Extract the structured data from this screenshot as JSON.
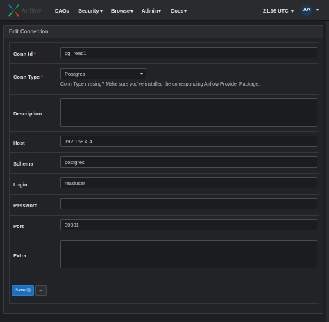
{
  "navbar": {
    "logo_text": "Airflow",
    "items": [
      {
        "label": "DAGs",
        "dropdown": false
      },
      {
        "label": "Security",
        "dropdown": true
      },
      {
        "label": "Browse",
        "dropdown": true
      },
      {
        "label": "Admin",
        "dropdown": true
      },
      {
        "label": "Docs",
        "dropdown": true
      }
    ],
    "time": "21:16 UTC",
    "avatar": "AA"
  },
  "panel": {
    "title": "Edit Connection"
  },
  "form": {
    "conn_id": {
      "label": "Conn Id",
      "required": "*",
      "value": "pg_read1"
    },
    "conn_type": {
      "label": "Conn Type",
      "required": "*",
      "value": "Postgres",
      "help": "Conn Type missing? Make sure you've installed the corresponding Airflow Provider Package."
    },
    "description": {
      "label": "Description",
      "value": ""
    },
    "host": {
      "label": "Host",
      "value": "192.168.4.4"
    },
    "schema": {
      "label": "Schema",
      "value": "postgres"
    },
    "login": {
      "label": "Login",
      "value": "readuser"
    },
    "password": {
      "label": "Password",
      "value": ""
    },
    "port": {
      "label": "Port",
      "value": "30991"
    },
    "extra": {
      "label": "Extra",
      "value": ""
    }
  },
  "actions": {
    "save_label": "Save",
    "back_label": "←"
  },
  "colors": {
    "accent": "#1c6fbf",
    "required": "#d9534f",
    "avatar_bg": "#1b3b5c"
  }
}
